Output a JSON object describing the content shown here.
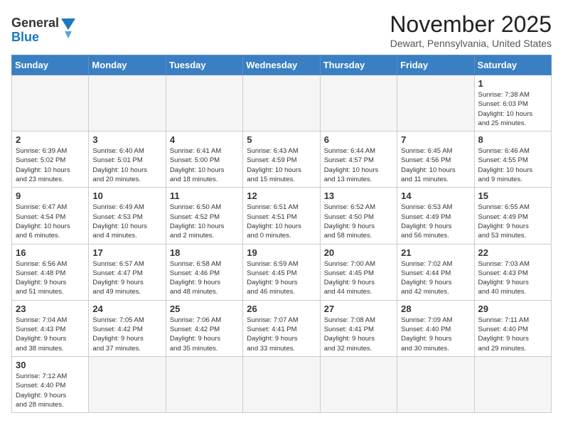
{
  "header": {
    "logo_general": "General",
    "logo_blue": "Blue",
    "month_title": "November 2025",
    "location": "Dewart, Pennsylvania, United States"
  },
  "days_of_week": [
    "Sunday",
    "Monday",
    "Tuesday",
    "Wednesday",
    "Thursday",
    "Friday",
    "Saturday"
  ],
  "weeks": [
    [
      {
        "day": "",
        "info": "",
        "empty": true
      },
      {
        "day": "",
        "info": "",
        "empty": true
      },
      {
        "day": "",
        "info": "",
        "empty": true
      },
      {
        "day": "",
        "info": "",
        "empty": true
      },
      {
        "day": "",
        "info": "",
        "empty": true
      },
      {
        "day": "",
        "info": "",
        "empty": true
      },
      {
        "day": "1",
        "info": "Sunrise: 7:38 AM\nSunset: 6:03 PM\nDaylight: 10 hours\nand 25 minutes."
      }
    ],
    [
      {
        "day": "2",
        "info": "Sunrise: 6:39 AM\nSunset: 5:02 PM\nDaylight: 10 hours\nand 23 minutes."
      },
      {
        "day": "3",
        "info": "Sunrise: 6:40 AM\nSunset: 5:01 PM\nDaylight: 10 hours\nand 20 minutes."
      },
      {
        "day": "4",
        "info": "Sunrise: 6:41 AM\nSunset: 5:00 PM\nDaylight: 10 hours\nand 18 minutes."
      },
      {
        "day": "5",
        "info": "Sunrise: 6:43 AM\nSunset: 4:59 PM\nDaylight: 10 hours\nand 15 minutes."
      },
      {
        "day": "6",
        "info": "Sunrise: 6:44 AM\nSunset: 4:57 PM\nDaylight: 10 hours\nand 13 minutes."
      },
      {
        "day": "7",
        "info": "Sunrise: 6:45 AM\nSunset: 4:56 PM\nDaylight: 10 hours\nand 11 minutes."
      },
      {
        "day": "8",
        "info": "Sunrise: 6:46 AM\nSunset: 4:55 PM\nDaylight: 10 hours\nand 9 minutes."
      }
    ],
    [
      {
        "day": "9",
        "info": "Sunrise: 6:47 AM\nSunset: 4:54 PM\nDaylight: 10 hours\nand 6 minutes."
      },
      {
        "day": "10",
        "info": "Sunrise: 6:49 AM\nSunset: 4:53 PM\nDaylight: 10 hours\nand 4 minutes."
      },
      {
        "day": "11",
        "info": "Sunrise: 6:50 AM\nSunset: 4:52 PM\nDaylight: 10 hours\nand 2 minutes."
      },
      {
        "day": "12",
        "info": "Sunrise: 6:51 AM\nSunset: 4:51 PM\nDaylight: 10 hours\nand 0 minutes."
      },
      {
        "day": "13",
        "info": "Sunrise: 6:52 AM\nSunset: 4:50 PM\nDaylight: 9 hours\nand 58 minutes."
      },
      {
        "day": "14",
        "info": "Sunrise: 6:53 AM\nSunset: 4:49 PM\nDaylight: 9 hours\nand 56 minutes."
      },
      {
        "day": "15",
        "info": "Sunrise: 6:55 AM\nSunset: 4:49 PM\nDaylight: 9 hours\nand 53 minutes."
      }
    ],
    [
      {
        "day": "16",
        "info": "Sunrise: 6:56 AM\nSunset: 4:48 PM\nDaylight: 9 hours\nand 51 minutes."
      },
      {
        "day": "17",
        "info": "Sunrise: 6:57 AM\nSunset: 4:47 PM\nDaylight: 9 hours\nand 49 minutes."
      },
      {
        "day": "18",
        "info": "Sunrise: 6:58 AM\nSunset: 4:46 PM\nDaylight: 9 hours\nand 48 minutes."
      },
      {
        "day": "19",
        "info": "Sunrise: 6:59 AM\nSunset: 4:45 PM\nDaylight: 9 hours\nand 46 minutes."
      },
      {
        "day": "20",
        "info": "Sunrise: 7:00 AM\nSunset: 4:45 PM\nDaylight: 9 hours\nand 44 minutes."
      },
      {
        "day": "21",
        "info": "Sunrise: 7:02 AM\nSunset: 4:44 PM\nDaylight: 9 hours\nand 42 minutes."
      },
      {
        "day": "22",
        "info": "Sunrise: 7:03 AM\nSunset: 4:43 PM\nDaylight: 9 hours\nand 40 minutes."
      }
    ],
    [
      {
        "day": "23",
        "info": "Sunrise: 7:04 AM\nSunset: 4:43 PM\nDaylight: 9 hours\nand 38 minutes."
      },
      {
        "day": "24",
        "info": "Sunrise: 7:05 AM\nSunset: 4:42 PM\nDaylight: 9 hours\nand 37 minutes."
      },
      {
        "day": "25",
        "info": "Sunrise: 7:06 AM\nSunset: 4:42 PM\nDaylight: 9 hours\nand 35 minutes."
      },
      {
        "day": "26",
        "info": "Sunrise: 7:07 AM\nSunset: 4:41 PM\nDaylight: 9 hours\nand 33 minutes."
      },
      {
        "day": "27",
        "info": "Sunrise: 7:08 AM\nSunset: 4:41 PM\nDaylight: 9 hours\nand 32 minutes."
      },
      {
        "day": "28",
        "info": "Sunrise: 7:09 AM\nSunset: 4:40 PM\nDaylight: 9 hours\nand 30 minutes."
      },
      {
        "day": "29",
        "info": "Sunrise: 7:11 AM\nSunset: 4:40 PM\nDaylight: 9 hours\nand 29 minutes."
      }
    ],
    [
      {
        "day": "30",
        "info": "Sunrise: 7:12 AM\nSunset: 4:40 PM\nDaylight: 9 hours\nand 28 minutes.",
        "last": true
      },
      {
        "day": "",
        "info": "",
        "empty": true,
        "last": true
      },
      {
        "day": "",
        "info": "",
        "empty": true,
        "last": true
      },
      {
        "day": "",
        "info": "",
        "empty": true,
        "last": true
      },
      {
        "day": "",
        "info": "",
        "empty": true,
        "last": true
      },
      {
        "day": "",
        "info": "",
        "empty": true,
        "last": true
      },
      {
        "day": "",
        "info": "",
        "empty": true,
        "last": true
      }
    ]
  ]
}
